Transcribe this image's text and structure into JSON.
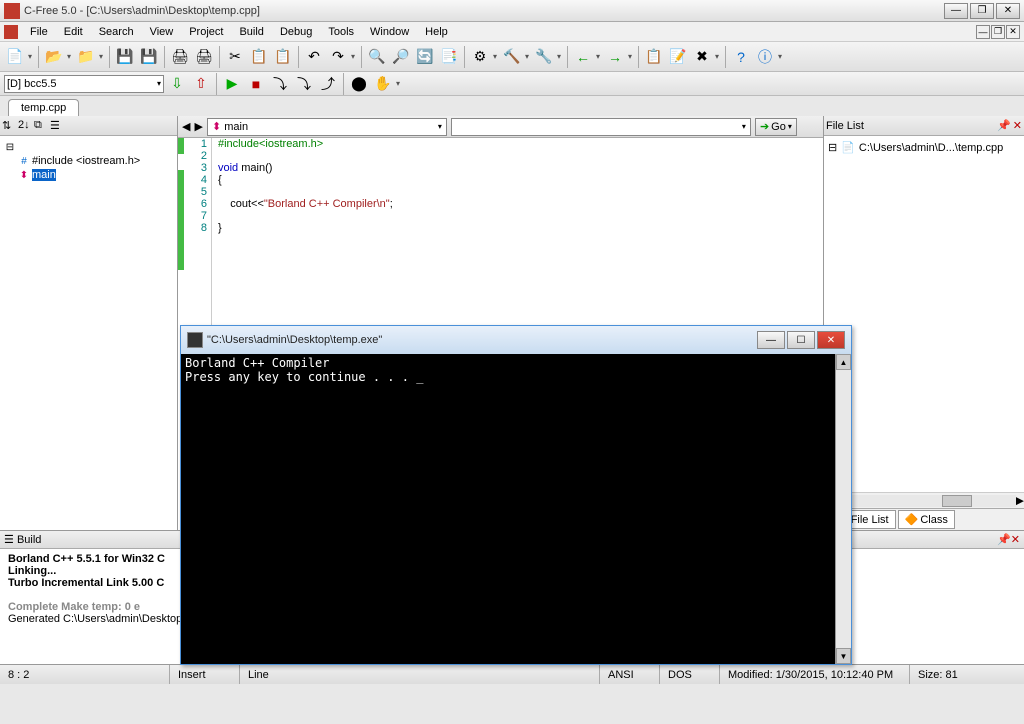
{
  "app": {
    "title": "C-Free 5.0 - [C:\\Users\\admin\\Desktop\\temp.cpp]"
  },
  "menu": [
    "File",
    "Edit",
    "Search",
    "View",
    "Project",
    "Build",
    "Debug",
    "Tools",
    "Window",
    "Help"
  ],
  "compiler_combo": "[D] bcc5.5",
  "file_tab": "temp.cpp",
  "tree": {
    "include": "#include <iostream.h>",
    "main": "main"
  },
  "nav": {
    "symbol": "main",
    "go": "Go"
  },
  "code": {
    "lines": [
      "1",
      "2",
      "3",
      "4",
      "5",
      "6",
      "7",
      "8"
    ],
    "l1_pp": "#include",
    "l1_inc": "<iostream.h>",
    "l3_kw": "void",
    "l3_fn": " main",
    "l3_rest": "()",
    "l4": "{",
    "l6_indent": "    cout<<",
    "l6_str": "\"Borland C++ Compiler\\n\"",
    "l6_end": ";",
    "l8": "}"
  },
  "right": {
    "title": "File List",
    "file": "C:\\Users\\admin\\D...\\temp.cpp",
    "tab1": "File List",
    "tab2": "Class"
  },
  "build": {
    "title": "Build",
    "l1": "Borland C++ 5.5.1 for Win32 C",
    "l2": "Linking...",
    "l3": "Turbo Incremental Link 5.00 C",
    "l4": "Complete Make temp: 0 e",
    "l5": "Generated C:\\Users\\admin\\Desktop\\temp.exe"
  },
  "status": {
    "pos": "8 : 2",
    "insert": "Insert",
    "line": "Line",
    "enc": "ANSI",
    "eol": "DOS",
    "mod": "Modified: 1/30/2015, 10:12:40 PM",
    "size": "Size: 81"
  },
  "console": {
    "title": "\"C:\\Users\\admin\\Desktop\\temp.exe\"",
    "out": "Borland C++ Compiler\nPress any key to continue . . . _"
  }
}
